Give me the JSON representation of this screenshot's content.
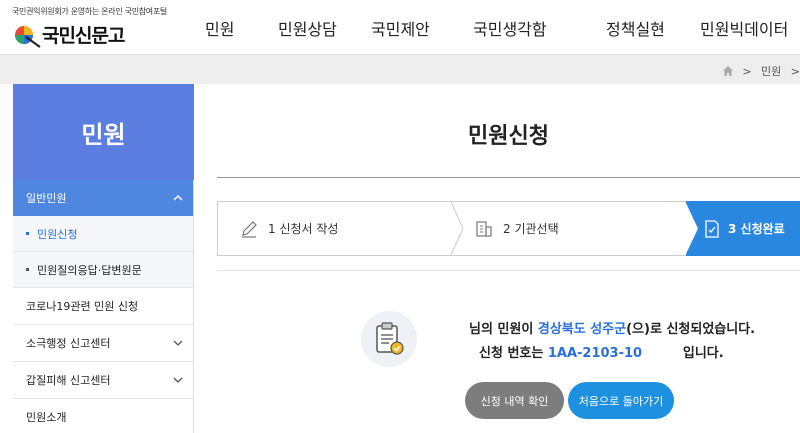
{
  "header": {
    "logo_tagline": "국민권익위원회가 운영하는 온라인 국민참여포털",
    "logo_text": "국민신문고",
    "nav": [
      "민원",
      "민원상담",
      "국민제안",
      "국민생각함",
      "정책실현",
      "민원빅데이터"
    ]
  },
  "breadcrumb": {
    "items": [
      "민원"
    ]
  },
  "sidebar": {
    "title": "민원",
    "active_group": "일반민원",
    "sub_items": [
      "민원신청",
      "민원질의응답·답변원문"
    ],
    "items": [
      "코로나19관련 민원 신청",
      "소극행정 신고센터",
      "갑질피해 신고센터",
      "민원소개"
    ]
  },
  "main": {
    "title": "민원신청",
    "steps": [
      "1 신청서 작성",
      "2 기관선택",
      "3 신청완료"
    ],
    "message": {
      "line1_prefix": "님의 민원이 ",
      "agency": "경상북도 성주군",
      "line1_suffix": "(으)로 신청되었습니다.",
      "line2_prefix": "신청 번호는 ",
      "reg_number": "1AA-2103-10",
      "line2_suffix": "입니다."
    },
    "buttons": {
      "check": "신청 내역 확인",
      "home": "처음으로 돌아가기"
    }
  },
  "colors": {
    "accent": "#2a87e0",
    "sidebar_head": "#5b7ee0",
    "highlight": "#2a6fdc"
  }
}
